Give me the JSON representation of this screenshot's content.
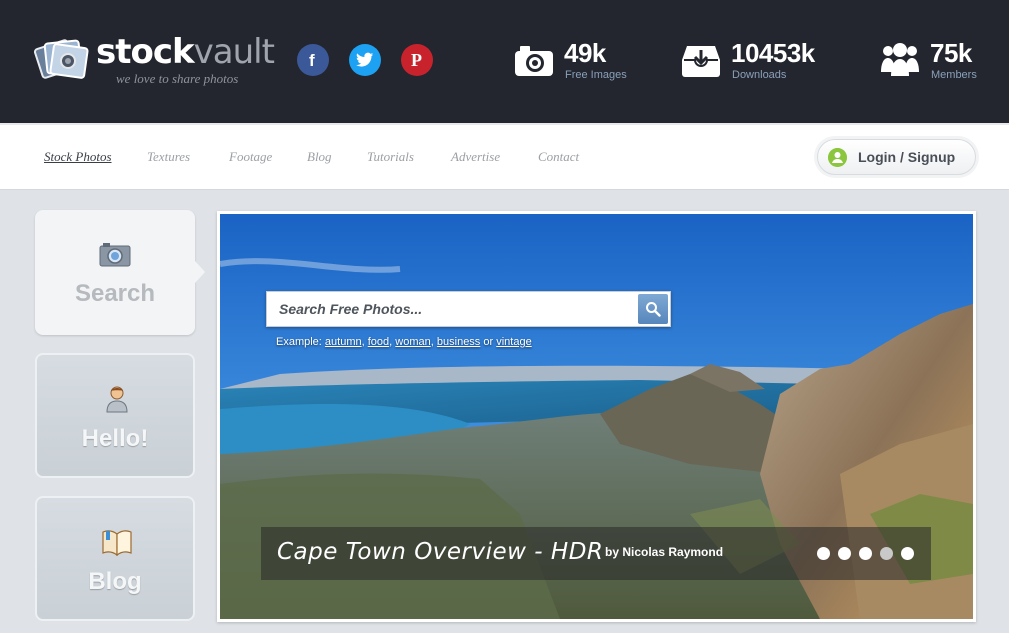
{
  "brand": {
    "name_strong": "stock",
    "name_light": "vault",
    "tagline": "we love to share photos"
  },
  "social": [
    {
      "name": "facebook",
      "glyph": "f",
      "color": "#3b5998"
    },
    {
      "name": "twitter",
      "color": "#1da1f2"
    },
    {
      "name": "pinterest",
      "glyph": "P",
      "color": "#c8232c"
    }
  ],
  "stats": [
    {
      "icon": "camera-icon",
      "value": "49k",
      "label": "Free Images"
    },
    {
      "icon": "download-box-icon",
      "value": "10453k",
      "label": "Downloads"
    },
    {
      "icon": "members-icon",
      "value": "75k",
      "label": "Members"
    }
  ],
  "nav": {
    "items": [
      "Stock Photos",
      "Textures",
      "Footage",
      "Blog",
      "Tutorials",
      "Advertise",
      "Contact"
    ],
    "active_index": 0,
    "login_label": "Login / Signup"
  },
  "tiles": [
    {
      "icon": "camera-icon",
      "label": "Search"
    },
    {
      "icon": "user-icon",
      "label": "Hello!"
    },
    {
      "icon": "book-icon",
      "label": "Blog"
    }
  ],
  "hero": {
    "search_placeholder": "Search Free Photos...",
    "example_prefix": "Example:",
    "examples": [
      "autumn",
      "food",
      "woman",
      "business",
      "vintage"
    ],
    "example_joiner": "or",
    "caption_title": "Cape Town Overview - HDR",
    "caption_by": "by Nicolas Raymond",
    "slides_total": 5,
    "slide_active_index": 3
  },
  "colors": {
    "header_bg": "#23262e",
    "accent_green": "#8cc63f",
    "search_button": "#5686bb"
  }
}
